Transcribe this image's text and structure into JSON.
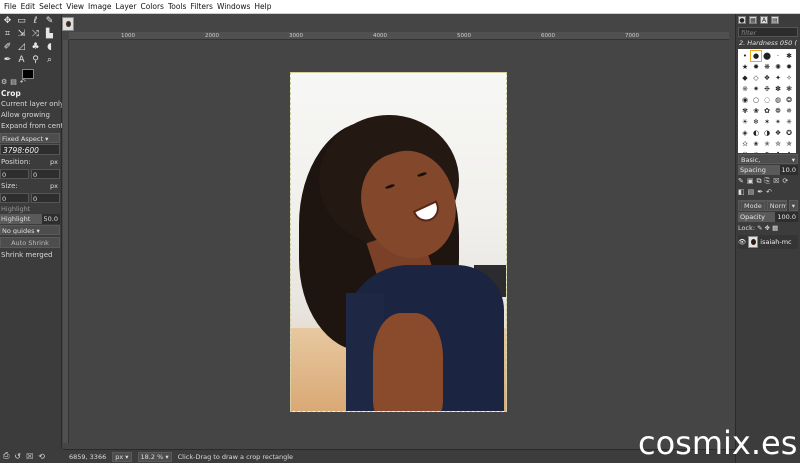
{
  "menubar": {
    "items": [
      "File",
      "Edit",
      "Select",
      "View",
      "Image",
      "Layer",
      "Colors",
      "Tools",
      "Filters",
      "Windows",
      "Help"
    ]
  },
  "toolbox": {
    "rows": [
      [
        "move-icon",
        "rect-select-icon",
        "lasso-icon",
        "fuzzy-select-icon"
      ],
      [
        "crop-icon",
        "transform-icon",
        "warp-icon",
        "bucket-fill-icon"
      ],
      [
        "pencil-icon",
        "eraser-icon",
        "clone-icon",
        "smudge-icon"
      ],
      [
        "path-icon",
        "text-icon",
        "color-picker-icon",
        "zoom-icon"
      ]
    ],
    "glyphs": {
      "move-icon": "✥",
      "rect-select-icon": "▭",
      "lasso-icon": "ℓ",
      "fuzzy-select-icon": "✎",
      "crop-icon": "⌗",
      "transform-icon": "⇲",
      "warp-icon": "⤨",
      "bucket-fill-icon": "▙",
      "pencil-icon": "✐",
      "eraser-icon": "◿",
      "clone-icon": "♣",
      "smudge-icon": "◖",
      "path-icon": "✒",
      "text-icon": "A",
      "color-picker-icon": "⚲",
      "zoom-icon": "⌕"
    }
  },
  "tool_options": {
    "title": "Crop",
    "current_layer_only": "Current layer only",
    "allow_growing": "Allow growing",
    "expand_from_center": "Expand from center",
    "fixed_aspect": "Fixed Aspect",
    "ratio_value": "3798:600",
    "position_label": "Position:",
    "position_unit": "px",
    "position_x": "0",
    "position_y": "0",
    "size_label": "Size:",
    "size_unit": "px",
    "size_w": "0",
    "size_h": "0",
    "highlight_label": "Highlight",
    "highlight_opacity_label": "Highlight",
    "highlight_opacity_value": "50.0",
    "guides": "No guides",
    "auto_shrink": "Auto Shrink",
    "shrink_merged": "Shrink merged"
  },
  "ruler": {
    "labels": [
      "1000",
      "2000",
      "3000",
      "4000",
      "5000",
      "6000",
      "7000"
    ]
  },
  "statusbar": {
    "coords": "6859, 3366",
    "unit": "px",
    "zoom": "18.2 %",
    "message": "Click-Drag to draw a crop rectangle"
  },
  "right_panel": {
    "filter_placeholder": "filter",
    "brush_name": "2. Hardness 050 (",
    "brush_preset": "Basic,",
    "spacing_label": "Spacing",
    "spacing_value": "10.0",
    "mode_label": "Mode",
    "mode_value": "Normal",
    "opacity_label": "Opacity",
    "opacity_value": "100.0",
    "lock_label": "Lock:",
    "layer_name": "isaiah-mc"
  },
  "watermark": "cosmix.es"
}
